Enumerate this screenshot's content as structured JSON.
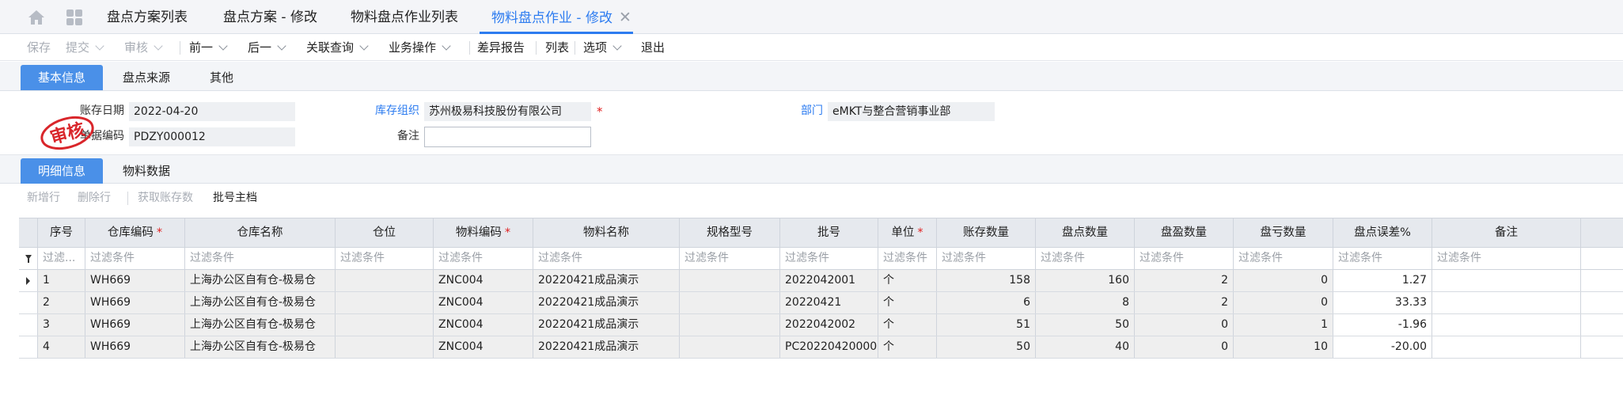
{
  "top_tabs": [
    {
      "label": "盘点方案列表"
    },
    {
      "label": "盘点方案 - 修改"
    },
    {
      "label": "物料盘点作业列表"
    },
    {
      "label": "物料盘点作业 - 修改",
      "close": "✕"
    }
  ],
  "toolbar": {
    "save": "保存",
    "submit": "提交",
    "audit": "审核",
    "prev": "前一",
    "next": "后一",
    "related_query": "关联查询",
    "business_ops": "业务操作",
    "diff_report": "差异报告",
    "list": "列表",
    "options": "选项",
    "exit": "退出"
  },
  "form_tabs": [
    "基本信息",
    "盘点来源",
    "其他"
  ],
  "form": {
    "stock_date_label": "账存日期",
    "stock_date": "2022-04-20",
    "doc_no_label": "单据编码",
    "doc_no": "PDZY000012",
    "stock_org_label": "库存组织",
    "stock_org": "苏州极易科技股份有限公司",
    "remark_label": "备注",
    "remark": "",
    "dept_label": "部门",
    "dept": "eMKT与整合营销事业部",
    "required_mark": "*",
    "stamp_text": "审核"
  },
  "detail_tabs": [
    "明细信息",
    "物料数据"
  ],
  "detail_toolbar": {
    "add_row": "新增行",
    "delete_row": "删除行",
    "fetch_stock": "获取账存数",
    "batch_master": "批号主档"
  },
  "grid": {
    "columns": [
      {
        "label": "序号",
        "required": false
      },
      {
        "label": "仓库编码",
        "required": true
      },
      {
        "label": "仓库名称",
        "required": false
      },
      {
        "label": "仓位",
        "required": false
      },
      {
        "label": "物料编码",
        "required": true
      },
      {
        "label": "物料名称",
        "required": false
      },
      {
        "label": "规格型号",
        "required": false
      },
      {
        "label": "批号",
        "required": false
      },
      {
        "label": "单位",
        "required": true
      },
      {
        "label": "账存数量",
        "required": false
      },
      {
        "label": "盘点数量",
        "required": false
      },
      {
        "label": "盘盈数量",
        "required": false
      },
      {
        "label": "盘亏数量",
        "required": false
      },
      {
        "label": "盘点误差%",
        "required": false
      },
      {
        "label": "备注",
        "required": false
      }
    ],
    "filter_first": "过滤...",
    "filter_text": "过滤条件",
    "rows": [
      [
        "1",
        "WH669",
        "上海办公区自有仓-极易仓",
        "",
        "ZNC004",
        "20220421成品演示",
        "",
        "2022042001",
        "个",
        "158",
        "160",
        "2",
        "0",
        "1.27",
        ""
      ],
      [
        "2",
        "WH669",
        "上海办公区自有仓-极易仓",
        "",
        "ZNC004",
        "20220421成品演示",
        "",
        "20220421",
        "个",
        "6",
        "8",
        "2",
        "0",
        "33.33",
        ""
      ],
      [
        "3",
        "WH669",
        "上海办公区自有仓-极易仓",
        "",
        "ZNC004",
        "20220421成品演示",
        "",
        "2022042002",
        "个",
        "51",
        "50",
        "0",
        "1",
        "-1.96",
        ""
      ],
      [
        "4",
        "WH669",
        "上海办公区自有仓-极易仓",
        "",
        "ZNC004",
        "20220421成品演示",
        "",
        "PC20220420000",
        "个",
        "50",
        "40",
        "0",
        "10",
        "-20.00",
        ""
      ]
    ]
  },
  "colors": {
    "accent": "#2d7cf0",
    "tab_active_bg": "#4a90e8",
    "required": "#e02020",
    "stamp": "#d9262b"
  },
  "icons": {
    "home": "home-icon",
    "apps": "apps-grid-icon",
    "close": "close-icon",
    "dropdown": "chevron-down-icon",
    "filter": "filter-icon",
    "current_row": "row-pointer-icon"
  }
}
